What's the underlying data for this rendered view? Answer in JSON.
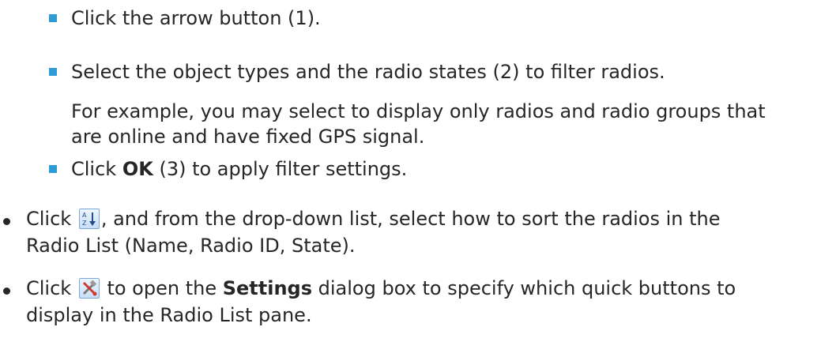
{
  "doc": {
    "step1": "Click the arrow button (1).",
    "step2": "Select the object types and the radio states (2) to filter radios.",
    "step2_example_l1": "For example, you may select to display only radios and radio groups that",
    "step2_example_l2": "are online and have fixed GPS signal.",
    "step3_pre": "Click ",
    "step3_bold": "OK",
    "step3_post": " (3) to apply filter settings.",
    "sort_pre": "Click ",
    "sort_post": ", and from the drop-down list, select how to sort the radios in the",
    "sort_l2": "Radio List (Name, Radio ID, State).",
    "settings_pre": "Click ",
    "settings_mid": " to open the ",
    "settings_bold": "Settings",
    "settings_post": " dialog box to specify which quick buttons to",
    "settings_l2": "display in the Radio List pane."
  },
  "icons": {
    "sort": "sort-az-icon",
    "settings": "settings-tools-icon"
  },
  "colors": {
    "bullet_square": "#2e9bd6",
    "text": "#262626"
  }
}
